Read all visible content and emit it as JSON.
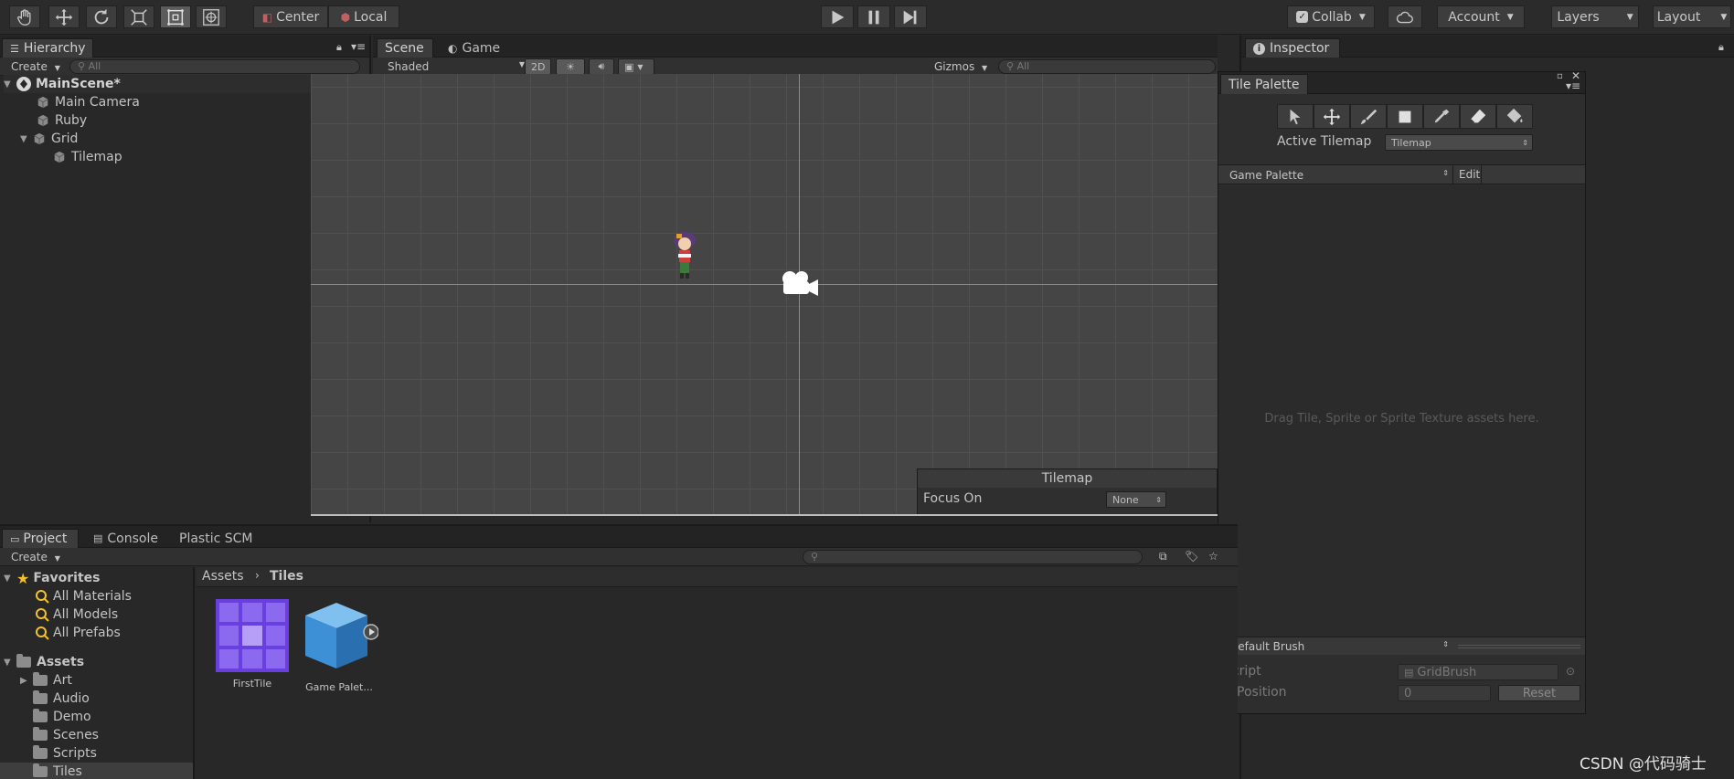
{
  "toolbar": {
    "pivot_center": "Center",
    "pivot_local": "Local",
    "collab": "Collab",
    "account": "Account",
    "layers": "Layers",
    "layout": "Layout"
  },
  "hierarchy": {
    "tab": "Hierarchy",
    "create": "Create",
    "search_placeholder": "All",
    "scene": "MainScene*",
    "items": [
      "Main Camera",
      "Ruby",
      "Grid",
      "Tilemap"
    ]
  },
  "scene": {
    "tab_scene": "Scene",
    "tab_game": "Game",
    "shading": "Shaded",
    "mode_2d": "2D",
    "gizmos": "Gizmos",
    "search_placeholder": "All",
    "overlay_title": "Tilemap",
    "focus_label": "Focus On",
    "focus_value": "None"
  },
  "inspector": {
    "tab": "Inspector"
  },
  "tile_palette": {
    "title": "Tile Palette",
    "active_tilemap_label": "Active Tilemap",
    "active_tilemap_value": "Tilemap",
    "palette": "Game Palette",
    "edit": "Edit",
    "drop_hint": "Drag Tile, Sprite or Sprite Texture assets here.",
    "brush": "Default Brush",
    "script_label": "Script",
    "script_value": "GridBrush",
    "zpos_label": "Z Position",
    "zpos_value": "0",
    "reset": "Reset"
  },
  "project": {
    "tabs": [
      "Project",
      "Console",
      "Plastic SCM"
    ],
    "create": "Create",
    "favorites": "Favorites",
    "favorite_items": [
      "All Materials",
      "All Models",
      "All Prefabs"
    ],
    "assets": "Assets",
    "asset_folders": [
      "Art",
      "Audio",
      "Demo",
      "Scenes",
      "Scripts",
      "Tiles"
    ],
    "breadcrumb_root": "Assets",
    "breadcrumb_current": "Tiles",
    "files": [
      {
        "name": "FirstTile"
      },
      {
        "name": "Game Palet..."
      }
    ]
  },
  "watermark": "CSDN @代码骑士",
  "colors": {
    "tile_purple": "#6a3fe0",
    "cube_blue": "#3d8fd6",
    "accent_blue": "#3a72b0",
    "star": "#f3c12a"
  }
}
